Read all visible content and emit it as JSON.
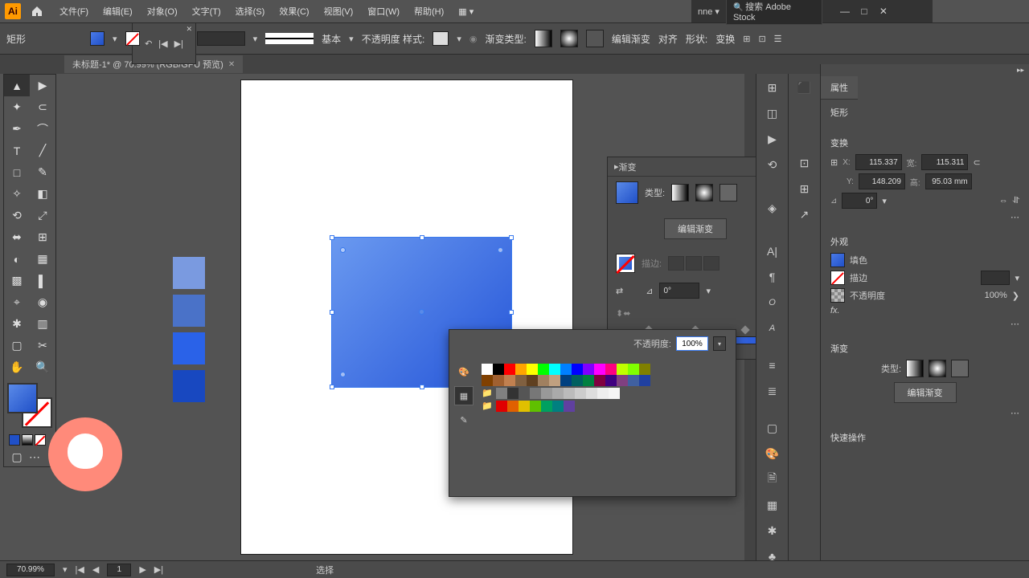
{
  "app": {
    "logo": "Ai"
  },
  "menu": {
    "file": "文件(F)",
    "edit": "编辑(E)",
    "object": "对象(O)",
    "text": "文字(T)",
    "select": "选择(S)",
    "effect": "效果(C)",
    "view": "视图(V)",
    "window": "窗口(W)",
    "help": "帮助(H)"
  },
  "workspace_dd": "nne",
  "search_placeholder": "搜索 Adobe Stock",
  "control": {
    "shape_label": "矩形",
    "basic": "基本",
    "opacity_label": "不透明度 样式:",
    "grad_type": "渐变类型:",
    "edit_grad": "编辑渐变",
    "align": "对齐",
    "shape": "形状:",
    "transform": "变换"
  },
  "doc_tab": "未标题-1* @ 70.99% (RGB/GPU 预览)",
  "grad_panel": {
    "title": "渐变",
    "type": "类型:",
    "edit": "编辑渐变",
    "stroke": "描边:",
    "angle": "0°"
  },
  "color_pop": {
    "opacity_label": "不透明度:",
    "opacity_value": "100%"
  },
  "props": {
    "tab": "属性",
    "kind": "矩形",
    "transform": "变换",
    "x": "115.337",
    "y": "148.209",
    "w": "115.311",
    "h": "95.03 mm",
    "rot": "0°",
    "appearance": "外观",
    "fill": "填色",
    "stroke": "描边",
    "opacity": "不透明度",
    "opacity_val": "100%",
    "grad": "渐变",
    "grad_type": "类型:",
    "edit_grad": "编辑渐变",
    "quick": "快速操作"
  },
  "status": {
    "zoom": "70.99%",
    "nav": "1",
    "sel": "选择"
  },
  "samples": [
    "#7a9ae0",
    "#4a72c8",
    "#2a62e8",
    "#1848c0"
  ],
  "swatch_rows": [
    [
      "#fff",
      "#000",
      "#ff0000",
      "#ffa500",
      "#ffff00",
      "#00ff00",
      "#00ffff",
      "#0080ff",
      "#0000ff",
      "#8000ff",
      "#ff00ff",
      "#ff0080",
      "#c0ff00",
      "#80ff00",
      "#808000"
    ],
    [
      "#804000",
      "#a06030",
      "#c08050",
      "#806040",
      "#604020",
      "#a08060",
      "#c0a080",
      "#004080",
      "#006060",
      "#008040",
      "#800040",
      "#400080",
      "#804080",
      "#4060a0",
      "#2040a0"
    ],
    [
      "#808080",
      "#333",
      "#555",
      "#777",
      "#999",
      "#aaa",
      "#bbb",
      "#ccc",
      "#ddd",
      "#eee",
      "#f5f5f5"
    ],
    [
      "#e00000",
      "#e06000",
      "#e0c000",
      "#60c000",
      "#00a060",
      "#008080",
      "#6040a0"
    ]
  ]
}
